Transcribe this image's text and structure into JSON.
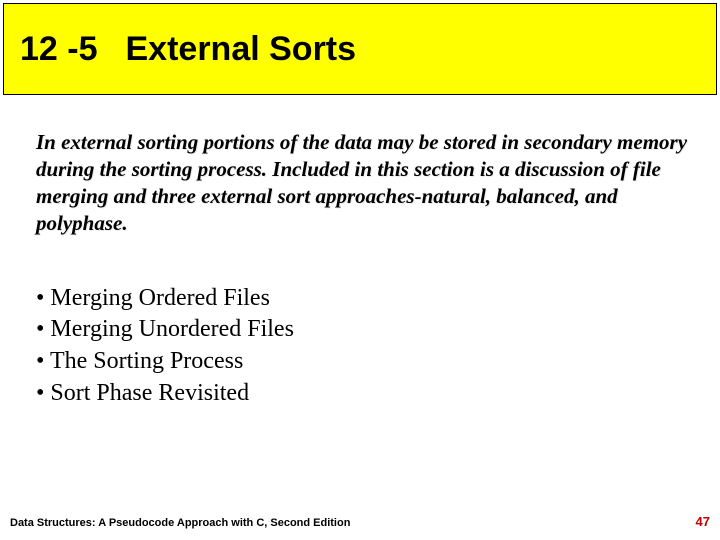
{
  "title": {
    "number": "12 -5",
    "text": "External Sorts"
  },
  "intro": "In external sorting portions of the data may be stored in secondary memory during the sorting process. Included in this section is a discussion of file merging and three external sort approaches-natural, balanced, and polyphase.",
  "bullets": [
    "Merging Ordered Files",
    "Merging Unordered Files",
    "The Sorting Process",
    "Sort Phase Revisited"
  ],
  "footer": {
    "source": "Data Structures: A Pseudocode Approach with C, Second Edition",
    "page": "47"
  }
}
